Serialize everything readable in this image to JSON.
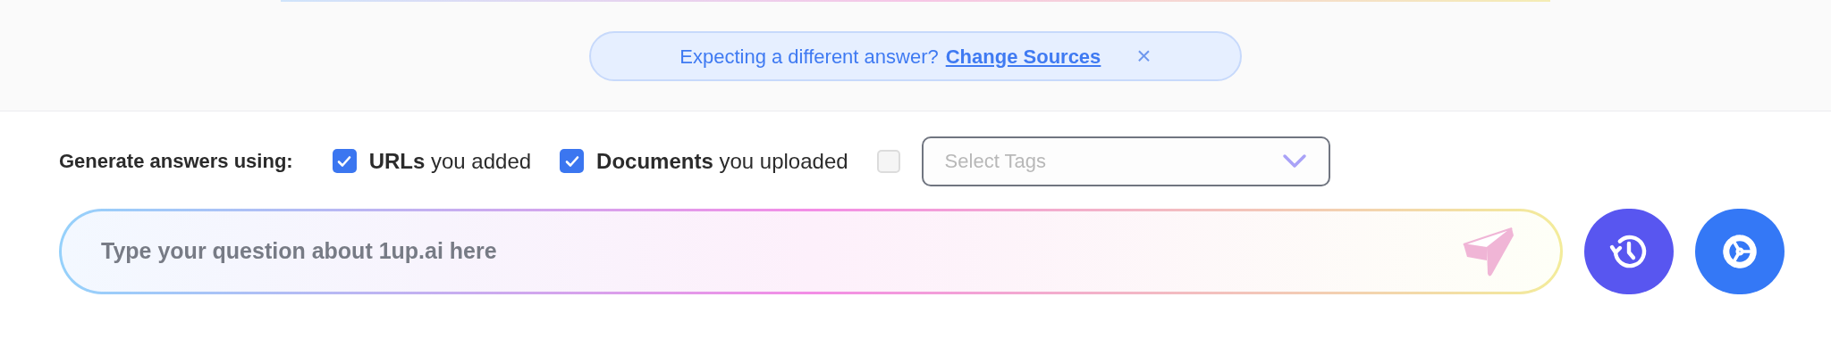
{
  "notice": {
    "text": "Expecting a different answer?",
    "link": "Change Sources",
    "close": "×"
  },
  "sources": {
    "label": "Generate answers using:",
    "options": [
      {
        "text": "**URLs** you added",
        "checked": true
      },
      {
        "text": "**Documents** you uploaded",
        "checked": true
      }
    ],
    "tags": {
      "checked": false,
      "placeholder": "Select Tags"
    }
  },
  "question": {
    "placeholder": "Type your question about 1up.ai here"
  }
}
